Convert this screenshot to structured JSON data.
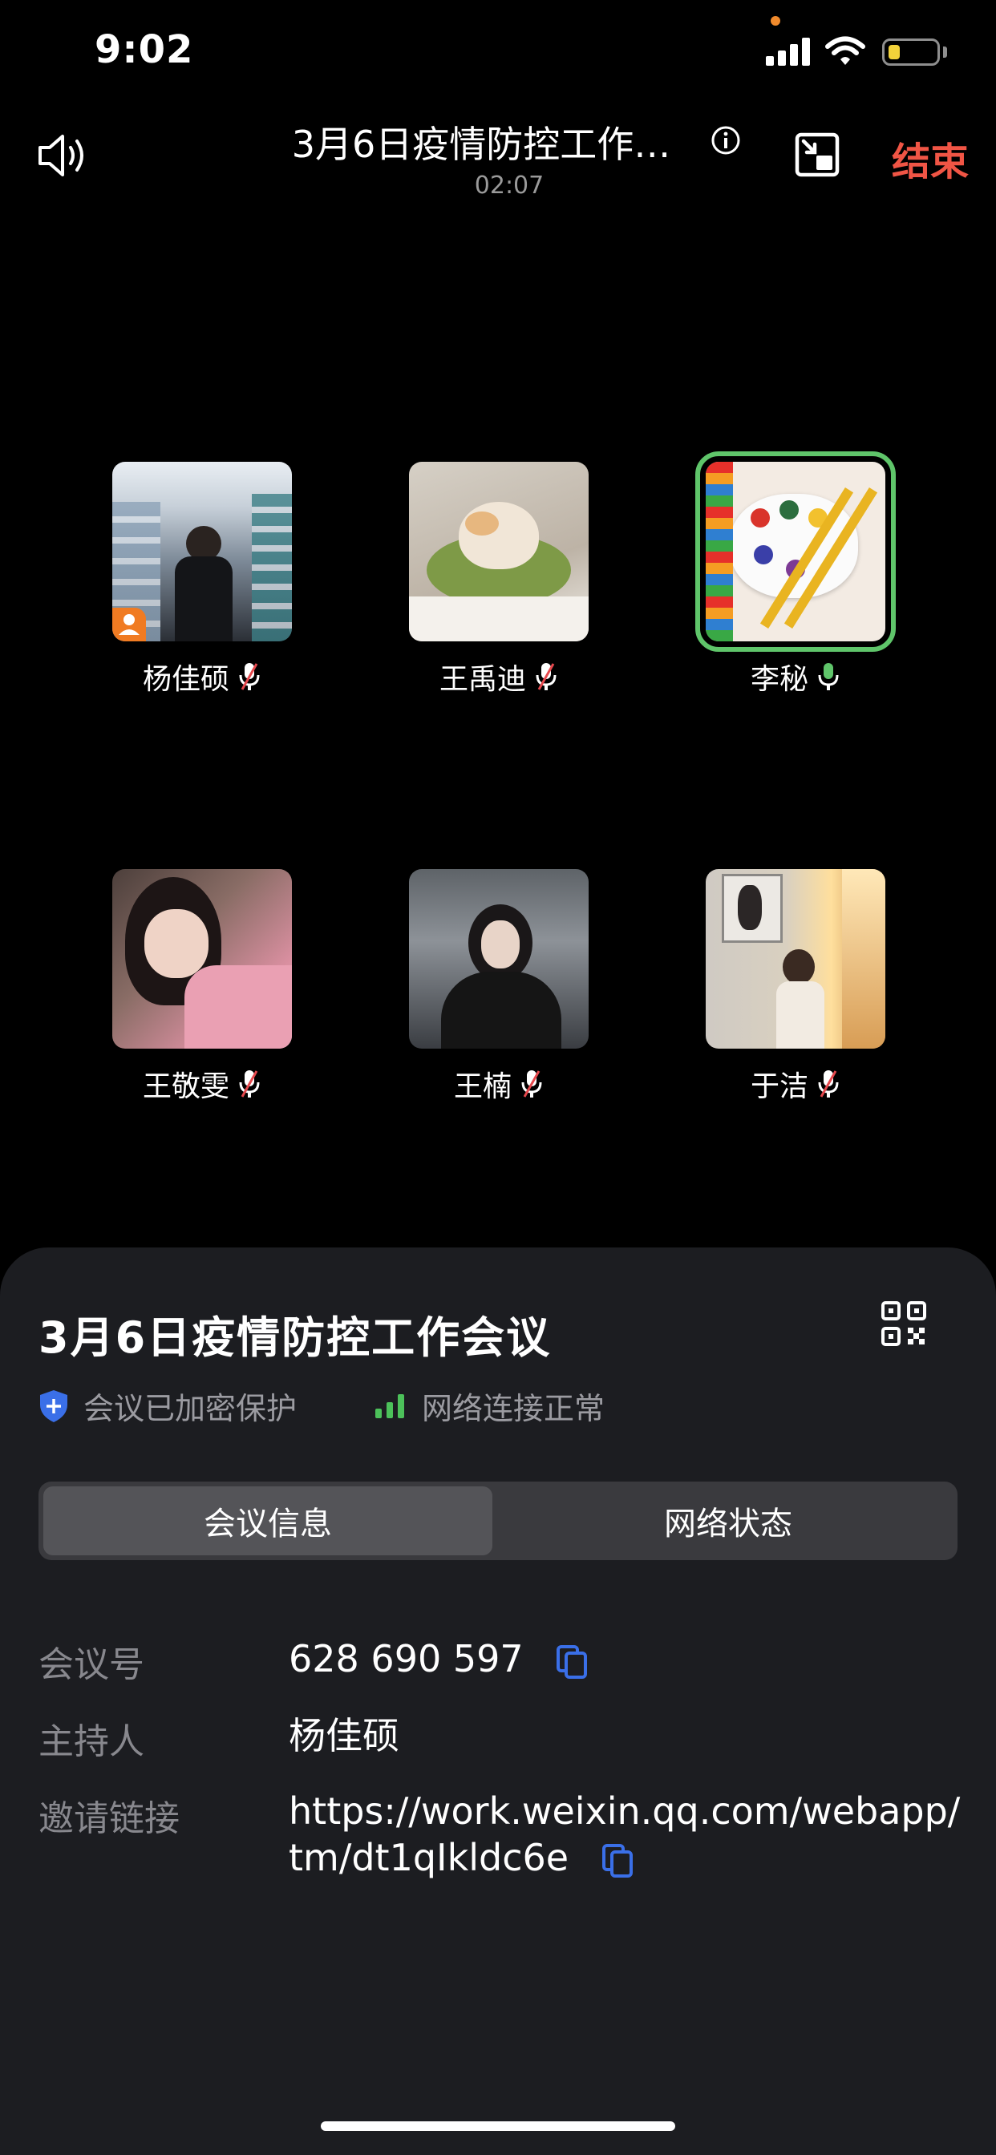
{
  "status_bar": {
    "time": "9:02"
  },
  "header": {
    "title": "3月6日疫情防控工作…",
    "timer": "02:07",
    "end_label": "结束"
  },
  "participants": [
    {
      "name": "杨佳硕",
      "mic": "muted",
      "is_host": true
    },
    {
      "name": "王禹迪",
      "mic": "muted"
    },
    {
      "name": "李秘",
      "mic": "speaking",
      "active_speaker": true
    },
    {
      "name": "王敬雯",
      "mic": "muted"
    },
    {
      "name": "王楠",
      "mic": "muted"
    },
    {
      "name": "于洁",
      "mic": "muted"
    }
  ],
  "sheet": {
    "title": "3月6日疫情防控工作会议",
    "encryption_label": "会议已加密保护",
    "network_label": "网络连接正常",
    "tabs": [
      {
        "label": "会议信息",
        "active": true
      },
      {
        "label": "网络状态",
        "active": false
      }
    ],
    "info": {
      "meeting_id_label": "会议号",
      "meeting_id": "628 690 597",
      "host_label": "主持人",
      "host": "杨佳硕",
      "link_label": "邀请链接",
      "link_line1": "https://work.weixin.qq.com/webapp/",
      "link_line2": "tm/dt1qIkldc6e"
    }
  },
  "colors": {
    "end": "#f05545",
    "active_speaker": "#5fc56a",
    "mic_on": "#5fc56a",
    "mic_muted_slash": "#e5484d",
    "accent": "#3a6fe8",
    "battery": "#f2d23a",
    "host_badge": "#f07b22",
    "status_dot": "#f08a2c"
  },
  "icons": {
    "speaker": "speaker-icon",
    "info": "info-icon",
    "pip": "minimize-window-icon",
    "qr": "qr-code-icon",
    "shield": "shield-icon",
    "signal": "network-signal-icon",
    "copy": "copy-icon",
    "mic": "microphone-icon",
    "mic_muted": "mic-muted-icon"
  }
}
